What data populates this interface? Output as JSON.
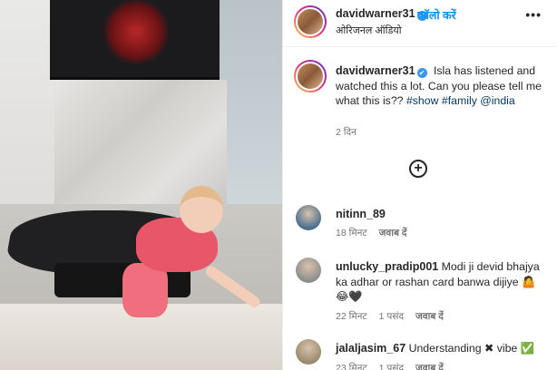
{
  "post": {
    "username": "davidwarner31",
    "verified_mark": "✔",
    "follow_label": "फ़ॉलो करें",
    "audio_label": "ओरिजनल ऑडियो",
    "more_label": "•••",
    "caption_text": "Isla has listened and watched this a lot. Can you please tell me what this is??",
    "hashtags": [
      "#show",
      "#family"
    ],
    "mention": "@india",
    "time_ago": "2 दिन",
    "add_comment_symbol": "+"
  },
  "comments": [
    {
      "username": "nitinn_89",
      "text": "",
      "time": "18 मिनट",
      "likes": "",
      "reply_label": "जवाब दें",
      "avatar_color": "#4a6f8e"
    },
    {
      "username": "unlucky_pradip001",
      "text": "Modi ji devid bhajya ka adhar or rashan card banwa dijiye 🤷 😂🖤",
      "time": "22 मिनट",
      "likes": "1 पसंद",
      "reply_label": "जवाब दें",
      "avatar_color": "#8d8d8d"
    },
    {
      "username": "jalaljasim_67",
      "text": "Understanding ✖ vibe ✅",
      "time": "23 मिनट",
      "likes": "1 पसंद",
      "reply_label": "जवाब दें",
      "avatar_color": "#9c8a6e"
    }
  ],
  "icons": {
    "verified": "verified-badge-icon",
    "more": "more-options-icon",
    "add_comment": "plus-circle-icon"
  },
  "colors": {
    "link_blue": "#0095f6",
    "verified_blue": "#3897f0",
    "hashtag": "#00376b",
    "muted": "#737373"
  }
}
